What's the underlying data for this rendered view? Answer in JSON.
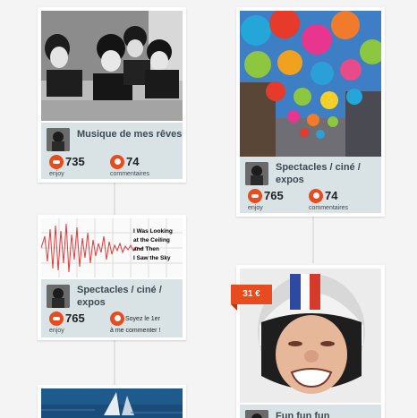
{
  "cards": [
    {
      "category": "Musique de mes rêves",
      "enjoy_count": "735",
      "enjoy_label": "enjoy",
      "comment_count": "74",
      "comment_label": "commentaires"
    },
    {
      "category_line1": "Spectacles / ciné /",
      "category_line2": "expos",
      "enjoy_count": "765",
      "enjoy_label": "enjoy",
      "comment_count": "74",
      "comment_label": "commentaires"
    },
    {
      "category_line1": "Spectacles / ciné /",
      "category_line2": "expos",
      "enjoy_count": "765",
      "enjoy_label": "enjoy",
      "comment_prompt_line1": "Soyez le 1er",
      "comment_prompt_line2": "à me commenter !",
      "image_caption": [
        "I Was Looking",
        "at the Ceiling",
        "and Then",
        "I Saw the Sky"
      ]
    },
    {
      "price": "31 €",
      "category": "Fun fun fun"
    }
  ]
}
